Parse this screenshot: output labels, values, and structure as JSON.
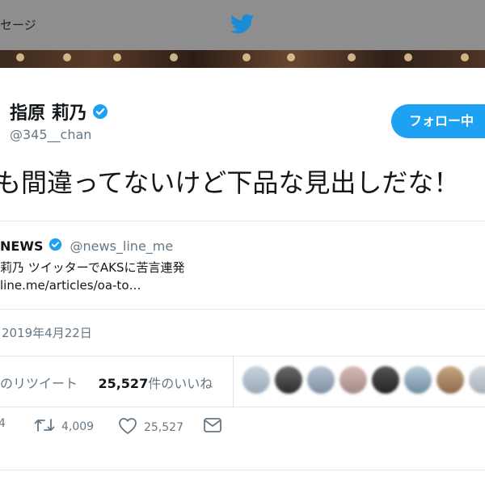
{
  "topbar": {
    "message_label": "セージ",
    "logo_icon": "twitter-bird-icon"
  },
  "profile": {
    "name": "指原 莉乃",
    "handle": "@345__chan",
    "verified_icon": "verified-badge-icon",
    "follow_label": "フォロー中"
  },
  "tweet": {
    "text": "も間違ってないけど下品な見出しだな！"
  },
  "quoted_card": {
    "name": "NEWS",
    "verified_icon": "verified-badge-icon",
    "handle": "@news_line_me",
    "title": "莉乃 ツイッターでAKSに苦言連発",
    "url": "line.me/articles/oa-to…"
  },
  "meta": {
    "date": "2019年4月22日"
  },
  "stats": {
    "retweet_suffix": "のリツイート",
    "likes_count": "25,527",
    "likes_suffix": "件のいいね"
  },
  "actions": {
    "reply_count": "4",
    "retweet_count": "4,009",
    "like_count": "25,527"
  },
  "colors": {
    "accent": "#1da1f2",
    "muted": "#657786",
    "text": "#14171a",
    "border": "#e1e8ed",
    "overlay": "#8a8a8a"
  }
}
